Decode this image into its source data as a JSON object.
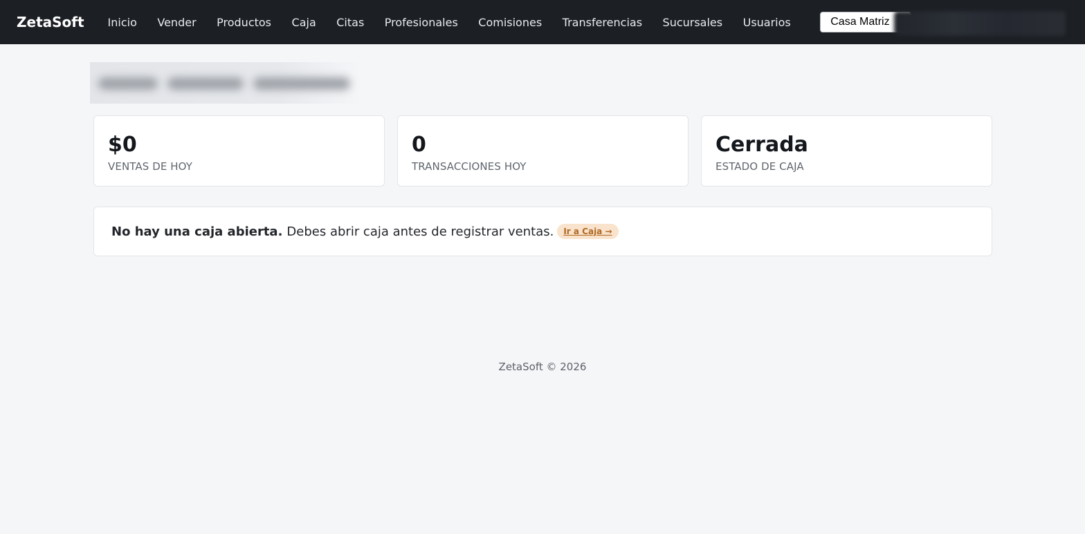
{
  "navbar": {
    "brand": "ZetaSoft",
    "links": [
      "Inicio",
      "Vender",
      "Productos",
      "Caja",
      "Citas",
      "Profesionales",
      "Comisiones",
      "Transferencias",
      "Sucursales",
      "Usuarios"
    ],
    "branch_select": {
      "value": "Casa Matriz",
      "icon": "chevron-down-icon"
    }
  },
  "stats": [
    {
      "value": "$0",
      "label": "VENTAS DE HOY"
    },
    {
      "value": "0",
      "label": "TRANSACCIONES HOY"
    },
    {
      "value": "Cerrada",
      "label": "ESTADO DE CAJA"
    }
  ],
  "alert": {
    "bold": "No hay una caja abierta.",
    "text": "Debes abrir caja antes de registrar ventas.",
    "link_label": "Ir a Caja →"
  },
  "footer": {
    "text": "ZetaSoft © 2026"
  },
  "colors": {
    "navbar_bg": "#1c1f24",
    "page_bg": "#f5f6f8",
    "alert_link_bg": "#f9e3cc",
    "alert_link_text": "#b06822"
  }
}
